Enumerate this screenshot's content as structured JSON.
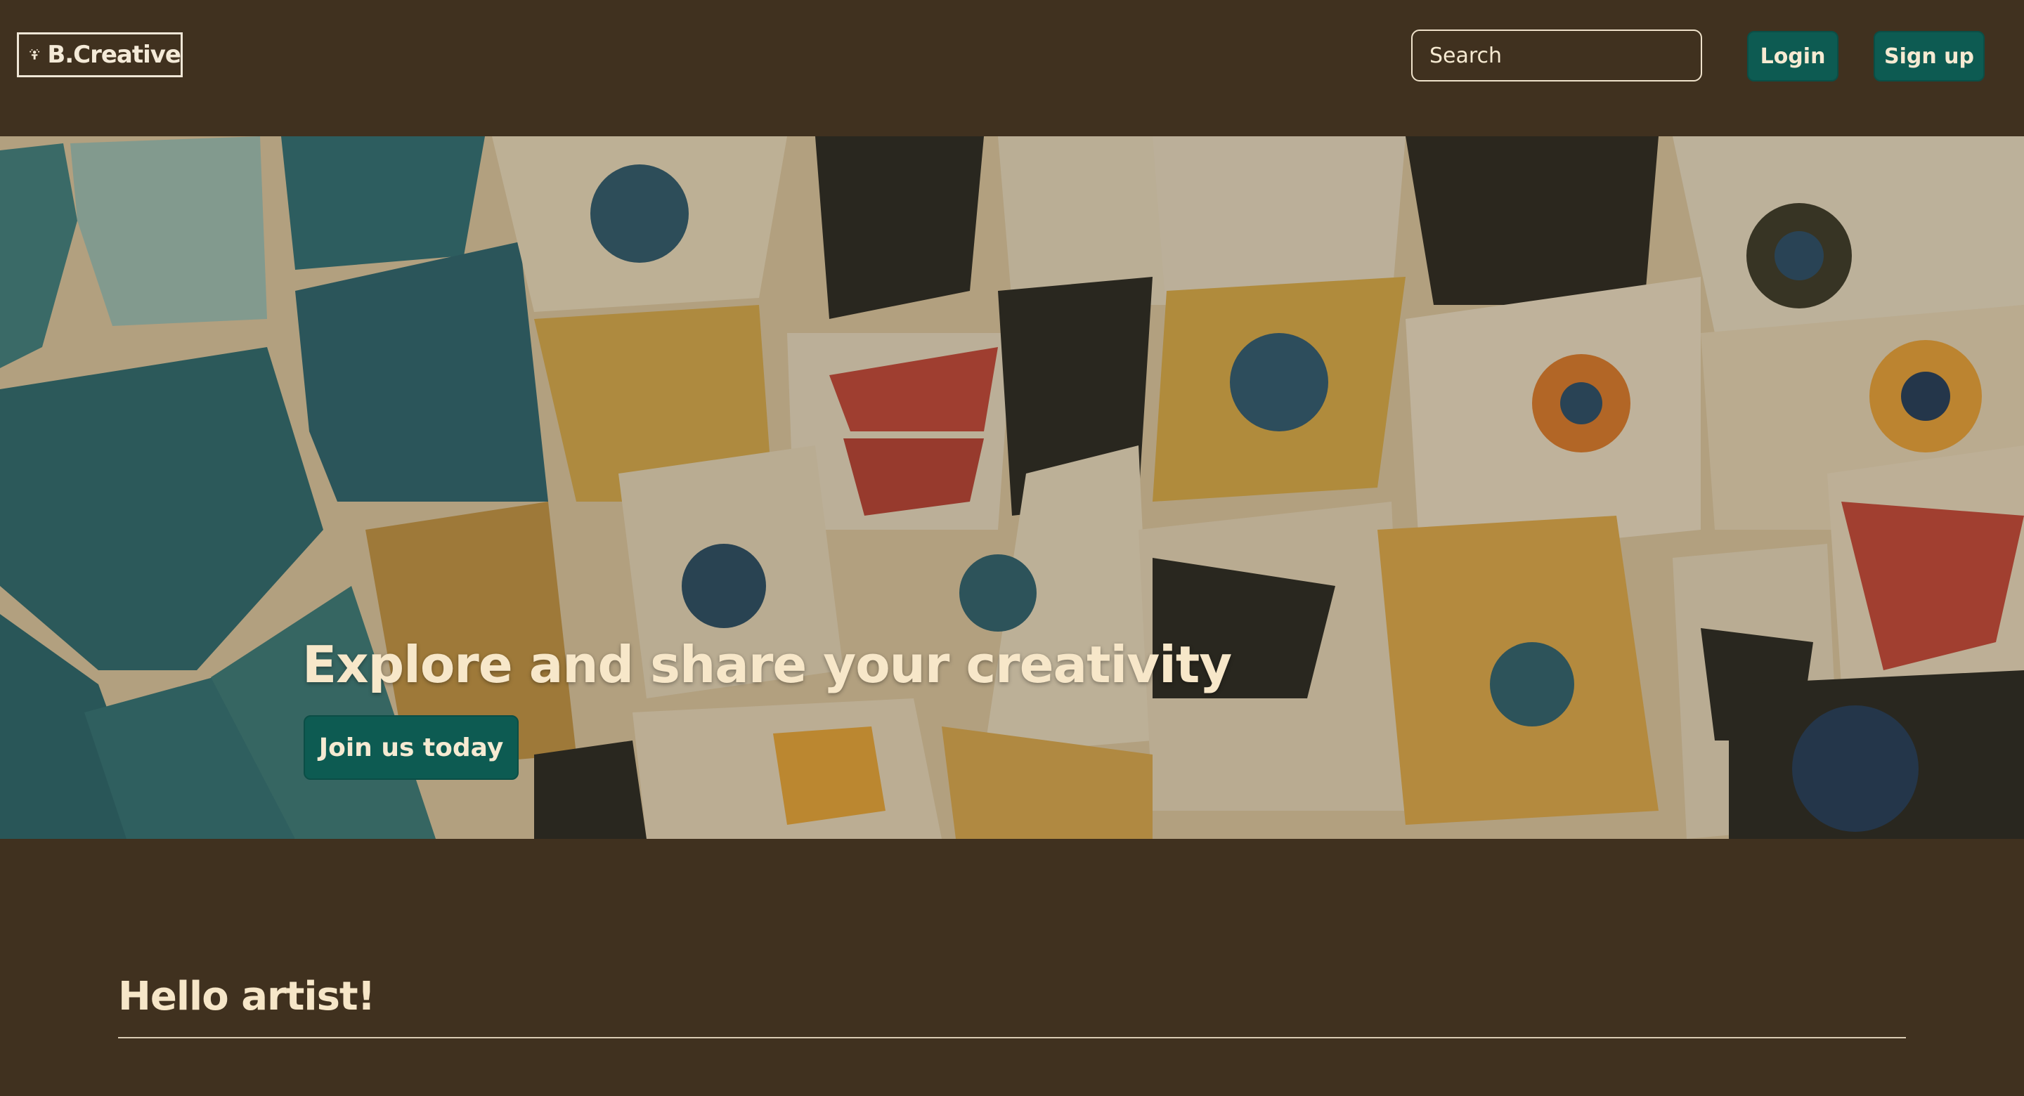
{
  "header": {
    "logo_text": "B.Creative",
    "search": {
      "placeholder": "Search",
      "value": ""
    },
    "login_label": "Login",
    "signup_label": "Sign up"
  },
  "hero": {
    "title": "Explore and share your creativity",
    "cta_label": "Join us today",
    "background": "mosaic-tile-photo"
  },
  "main": {
    "greeting": "Hello artist!"
  },
  "colors": {
    "page_background": "#40311f",
    "accent_button": "#0d5b52",
    "text": "#f6ead2"
  },
  "icons": [
    "logo-person-icon"
  ]
}
